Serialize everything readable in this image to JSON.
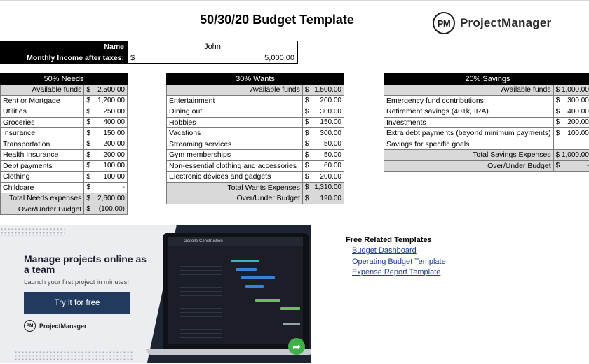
{
  "title": "50/30/20 Budget Template",
  "logo": {
    "mark": "PM",
    "name": "ProjectManager"
  },
  "info": {
    "name_label": "Name",
    "name_value": "John",
    "income_label": "Monthly Income after taxes:",
    "income_currency": "$",
    "income_value": "5,000.00"
  },
  "needs": {
    "header": "50% Needs",
    "available_label": "Available funds",
    "available_cur": "$",
    "available_value": "2,500.00",
    "items": [
      {
        "label": "Rent or Mortgage",
        "cur": "$",
        "value": "1,200.00"
      },
      {
        "label": "Utilities",
        "cur": "$",
        "value": "250.00"
      },
      {
        "label": "Groceries",
        "cur": "$",
        "value": "400.00"
      },
      {
        "label": "Insurance",
        "cur": "$",
        "value": "150.00"
      },
      {
        "label": "Transportation",
        "cur": "$",
        "value": "200.00"
      },
      {
        "label": "Health Insurance",
        "cur": "$",
        "value": "200.00"
      },
      {
        "label": "Debt payments",
        "cur": "$",
        "value": "100.00"
      },
      {
        "label": "Clothing",
        "cur": "$",
        "value": "100.00"
      },
      {
        "label": "Childcare",
        "cur": "$",
        "value": "-"
      }
    ],
    "total_label": "Total Needs expenses",
    "total_cur": "$",
    "total_value": "2,600.00",
    "over_label": "Over/Under Budget",
    "over_cur": "$",
    "over_value": "(100.00)"
  },
  "wants": {
    "header": "30% Wants",
    "available_label": "Available funds",
    "available_cur": "$",
    "available_value": "1,500.00",
    "items": [
      {
        "label": "Entertainment",
        "cur": "$",
        "value": "200.00"
      },
      {
        "label": "Dining out",
        "cur": "$",
        "value": "300.00"
      },
      {
        "label": "Hobbies",
        "cur": "$",
        "value": "150.00"
      },
      {
        "label": "Vacations",
        "cur": "$",
        "value": "300.00"
      },
      {
        "label": "Streaming services",
        "cur": "$",
        "value": "50.00"
      },
      {
        "label": "Gym memberships",
        "cur": "$",
        "value": "50.00"
      },
      {
        "label": "Non-essential clothing and accessories",
        "cur": "$",
        "value": "60.00"
      },
      {
        "label": "Electronic devices and gadgets",
        "cur": "$",
        "value": "200.00"
      }
    ],
    "total_label": "Total Wants Expenses",
    "total_cur": "$",
    "total_value": "1,310.00",
    "over_label": "Over/Under Budget",
    "over_cur": "$",
    "over_value": "190.00"
  },
  "savings": {
    "header": "20% Savings",
    "available_label": "Available funds",
    "available_value": "$ 1,000.00",
    "items": [
      {
        "label": "Emergency fund contributions",
        "cur": "$",
        "value": "300.00"
      },
      {
        "label": "Retirement savings (401k, IRA)",
        "cur": "$",
        "value": "400.00"
      },
      {
        "label": "Investments",
        "cur": "$",
        "value": "200.00"
      },
      {
        "label": "Extra debt payments (beyond minimum payments)",
        "cur": "$",
        "value": "100.00"
      },
      {
        "label": "Savings for specific goals",
        "cur": "",
        "value": ""
      }
    ],
    "total_label": "Total Savings Expenses",
    "total_value": "$ 1,000.00",
    "over_label": "Over/Under Budget",
    "over_cur": "$",
    "over_value": "-"
  },
  "banner": {
    "heading": "Manage projects online as a team",
    "sub": "Launch your first project in minutes!",
    "button": "Try it for free",
    "logo_mark": "PM",
    "logo_name": "ProjectManager",
    "screen_title": "Goselle Construction"
  },
  "related": {
    "title": "Free Related Templates",
    "links": [
      "Budget Dashboard",
      "Operating Budget Template",
      "Expense Report Template"
    ]
  }
}
